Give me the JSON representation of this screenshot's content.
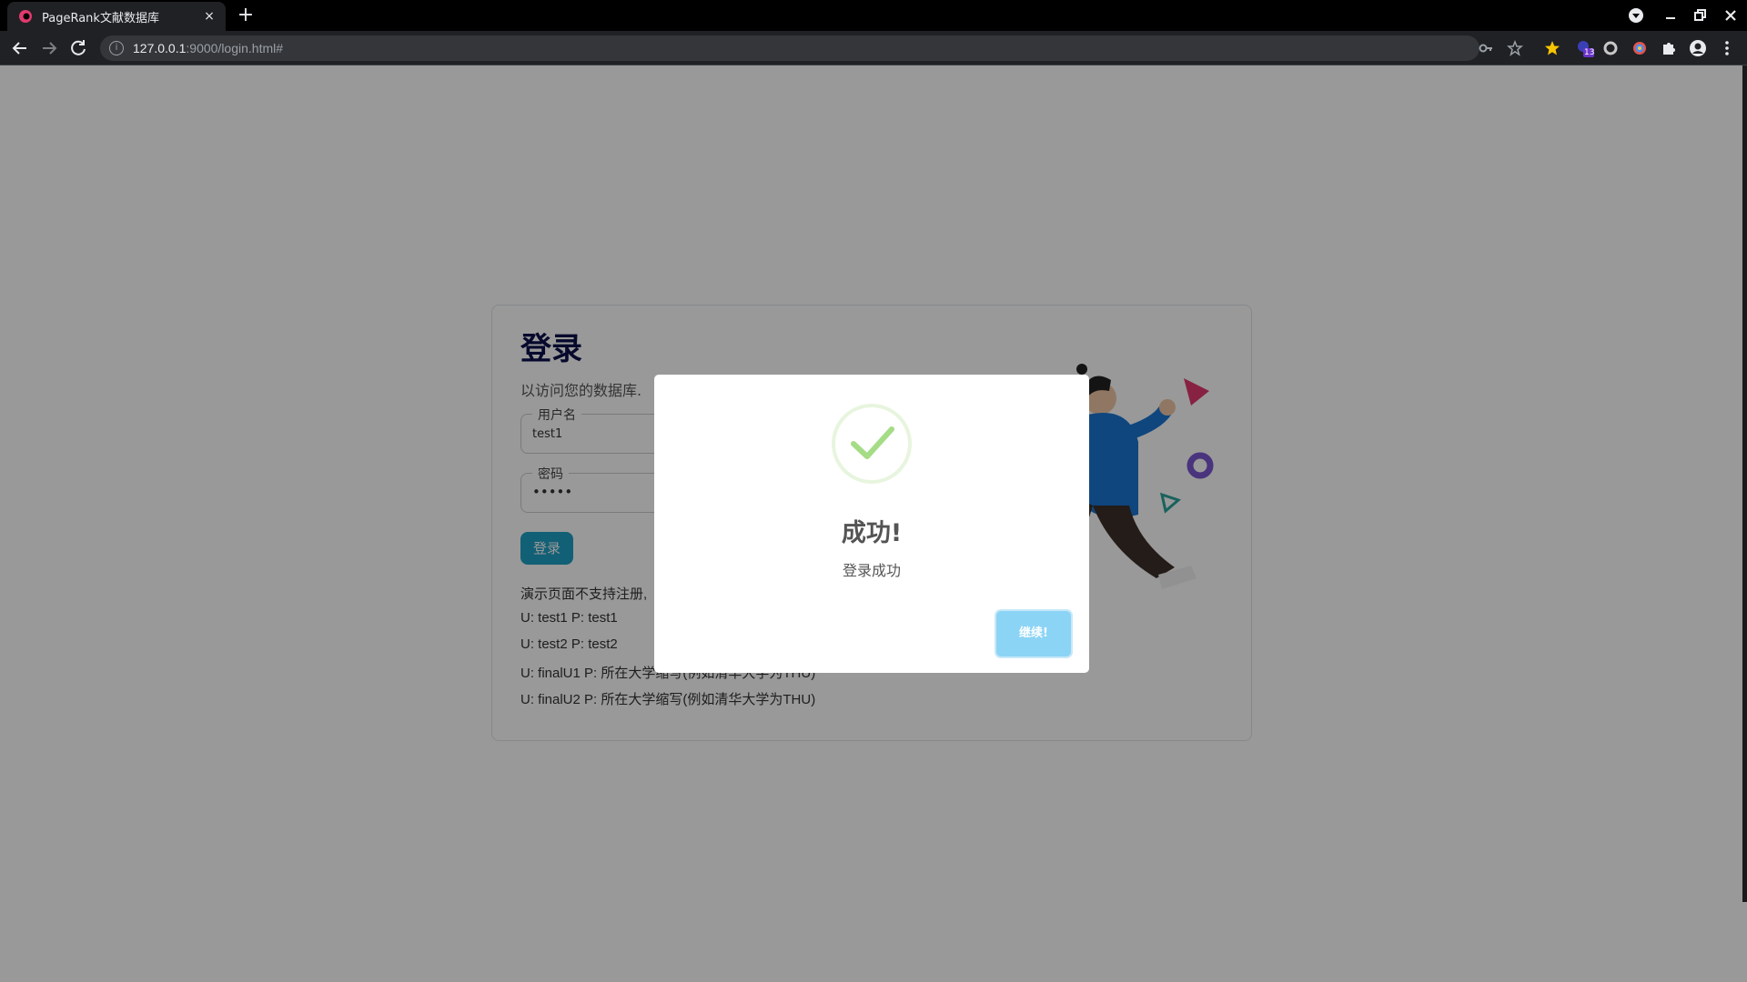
{
  "browser": {
    "tab_title": "PageRank文献数据库",
    "tab_close": "×",
    "new_tab": "+",
    "url_host": "127.0.0.1",
    "url_rest": ":9000/login.html#",
    "extension_badge": "13"
  },
  "login": {
    "title": "登录",
    "subtitle": "以访问您的数据库.",
    "username_label": "用户名",
    "username_value": "test1",
    "password_label": "密码",
    "password_value": "•••••",
    "submit_label": "登录",
    "info_lines": [
      "演示页面不支持注册,",
      "U: test1 P: test1",
      "U: test2 P: test2",
      "U: finalU1 P: 所在大学缩写(例如清华大学为THU)",
      "U: finalU2 P: 所在大学缩写(例如清华大学为THU)"
    ]
  },
  "modal": {
    "title": "成功!",
    "text": "登录成功",
    "confirm_label": "继续!"
  },
  "colors": {
    "overlay": "rgba(0,0,0,0.4)",
    "success_green": "#a5dc86",
    "confirm_blue": "#8cd4f5",
    "login_button": "#1ea0c4",
    "title_navy": "#0b0f4a"
  }
}
